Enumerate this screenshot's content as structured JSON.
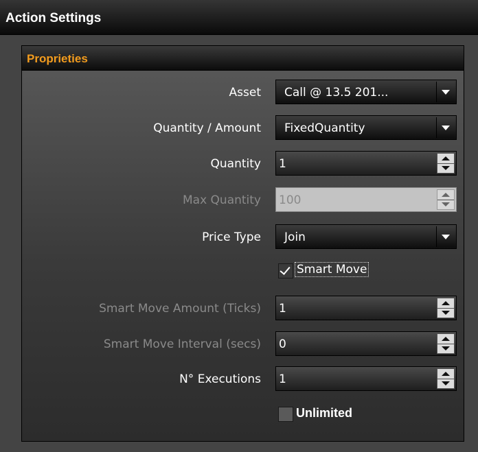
{
  "window": {
    "title": "Action Settings"
  },
  "panel": {
    "title": "Proprieties"
  },
  "fields": {
    "asset": {
      "label": "Asset",
      "value": "Call @ 13.5 201..."
    },
    "quantity_amount": {
      "label": "Quantity / Amount",
      "value": "FixedQuantity"
    },
    "quantity": {
      "label": "Quantity",
      "value": "1"
    },
    "max_quantity": {
      "label": "Max Quantity",
      "value": "100",
      "disabled": true
    },
    "price_type": {
      "label": "Price Type",
      "value": "Join"
    },
    "smart_move": {
      "label": "Smart Move",
      "checked": true
    },
    "smart_move_amount": {
      "label": "Smart Move Amount (Ticks)",
      "value": "1"
    },
    "smart_move_interval": {
      "label": "Smart Move Interval (secs)",
      "value": "0"
    },
    "executions": {
      "label": "N° Executions",
      "value": "1"
    },
    "unlimited": {
      "label": "Unlimited",
      "checked": false
    }
  },
  "colors": {
    "panel_title": "#f39c1e",
    "disabled_label": "#8a8a8a",
    "disabled_field": "#c3c3c3"
  }
}
